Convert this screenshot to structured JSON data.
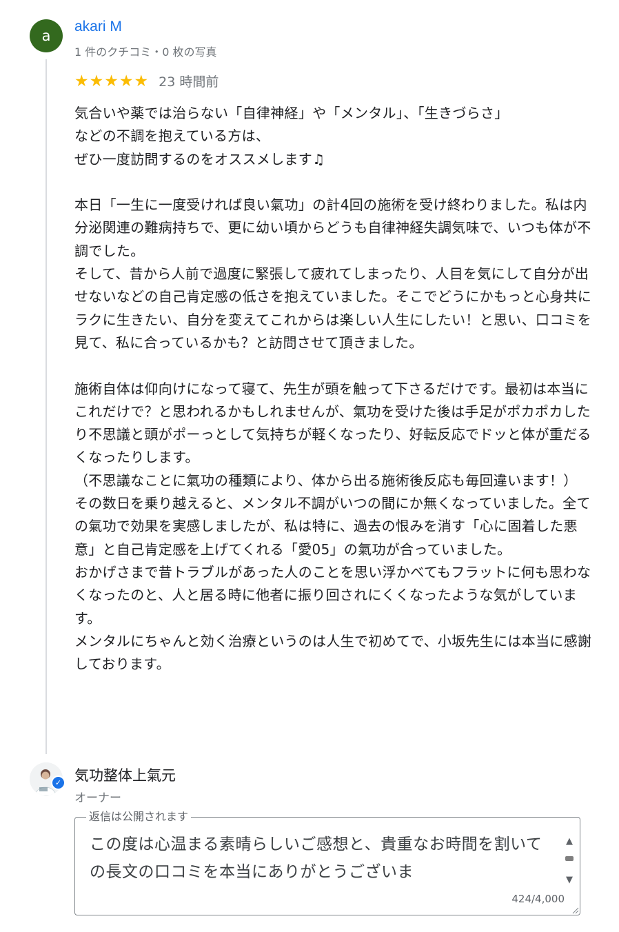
{
  "reviewer": {
    "avatar_letter": "a",
    "avatar_color": "#33691e",
    "name": "akari M",
    "meta": "1 件のクチコミ・0 枚の写真"
  },
  "rating": {
    "stars": 5,
    "max_stars": 5,
    "star_color": "#fbbc04",
    "time": "23 時間前"
  },
  "review": {
    "text": "気合いや薬では治らない「自律神経」や「メンタル」、「生きづらさ」\nなどの不調を抱えている方は、\nぜひ一度訪問するのをオススメします♫\n\n本日「一生に一度受ければ良い氣功」の計4回の施術を受け終わりました。私は内分泌関連の難病持ちで、更に幼い頃からどうも自律神経失調気味で、いつも体が不調でした。\nそして、昔から人前で過度に緊張して疲れてしまったり、人目を気にして自分が出せないなどの自己肯定感の低さを抱えていました。そこでどうにかもっと心身共にラクに生きたい、自分を変えてこれからは楽しい人生にしたい！と思い、口コミを見て、私に合っているかも？と訪問させて頂きました。\n\n施術自体は仰向けになって寝て、先生が頭を触って下さるだけです。最初は本当にこれだけで？と思われるかもしれませんが、氣功を受けた後は手足がポカポカしたり不思議と頭がポーっとして気持ちが軽くなったり、好転反応でドッと体が重だるくなったりします。\n（不思議なことに氣功の種類により、体から出る施術後反応も毎回違います！）\nその数日を乗り越えると、メンタル不調がいつの間にか無くなっていました。全ての氣功で効果を実感しましたが、私は特に、過去の恨みを消す「心に固着した悪意」と自己肯定感を上げてくれる「愛05」の氣功が合っていました。\nおかげさまで昔トラブルがあった人のことを思い浮かべてもフラットに何も思わなくなったのと、人と居る時に他者に振り回されにくくなったような気がしています。\nメンタルにちゃんと効く治療というのは人生で初めてで、小坂先生には本当に感謝しております。"
  },
  "owner": {
    "name": "気功整体上氣元",
    "role": "オーナー",
    "verified": true
  },
  "reply": {
    "legend": "返信は公開されます",
    "text": "この度は心温まる素晴らしいご感想と、貴重なお時間を割いての長文の口コミを本当にありがとうございま",
    "char_count": "424/4,000"
  },
  "icons": {
    "star": "star-icon",
    "verified": "verified-check-icon",
    "scroll_up": "triangle-up-icon",
    "scroll_down": "triangle-down-icon",
    "resize": "resize-handle-icon"
  },
  "colors": {
    "link_blue": "#1a73e8",
    "meta_gray": "#70757a"
  }
}
